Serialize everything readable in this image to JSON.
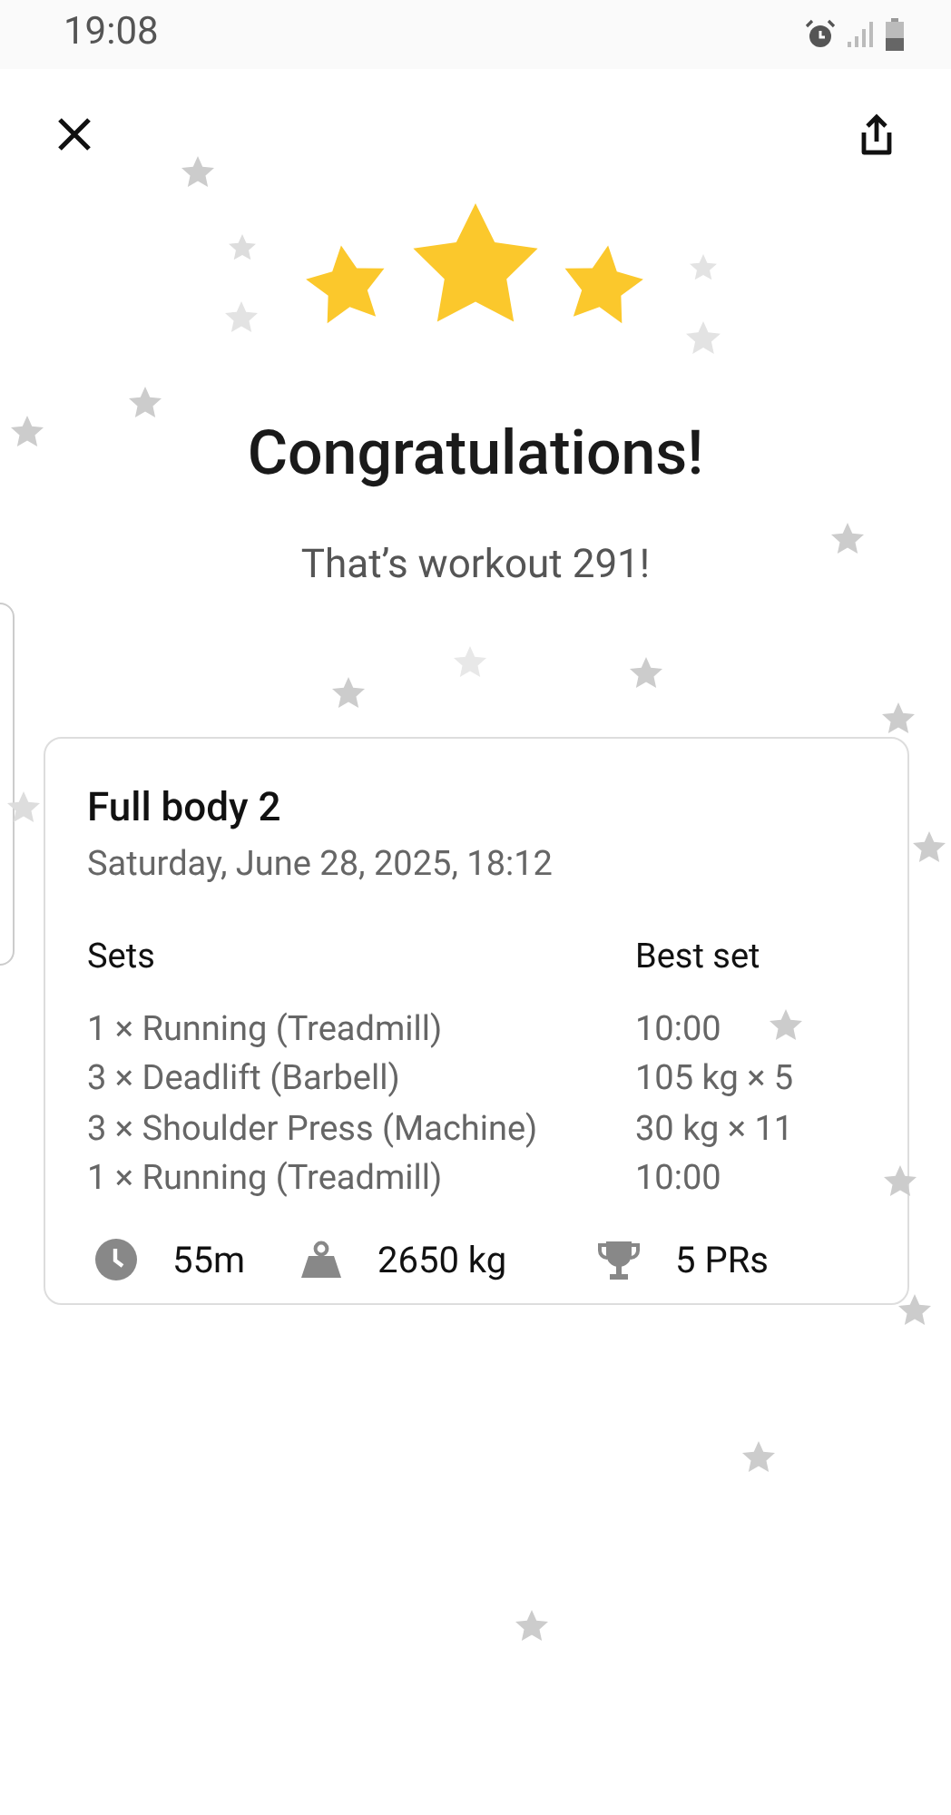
{
  "status_bar": {
    "time": "19:08"
  },
  "title": "Congratulations!",
  "subtitle": "That’s workout 291!",
  "workout": {
    "name": "Full body 2",
    "date": "Saturday, June 28, 2025, 18:12",
    "columns": [
      "Sets",
      "Best set"
    ],
    "rows": [
      {
        "sets": "1 × Running (Treadmill)",
        "best": "10:00"
      },
      {
        "sets": "3 × Deadlift (Barbell)",
        "best": "105 kg × 5"
      },
      {
        "sets": "3 × Shoulder Press (Machine)",
        "best": "30 kg × 11"
      },
      {
        "sets": "1 × Running (Treadmill)",
        "best": "10:00"
      }
    ],
    "stats": [
      {
        "kind": "duration",
        "value": "55m"
      },
      {
        "kind": "volume",
        "value": "2650 kg"
      },
      {
        "kind": "prs",
        "value": "5 PRs"
      }
    ]
  }
}
